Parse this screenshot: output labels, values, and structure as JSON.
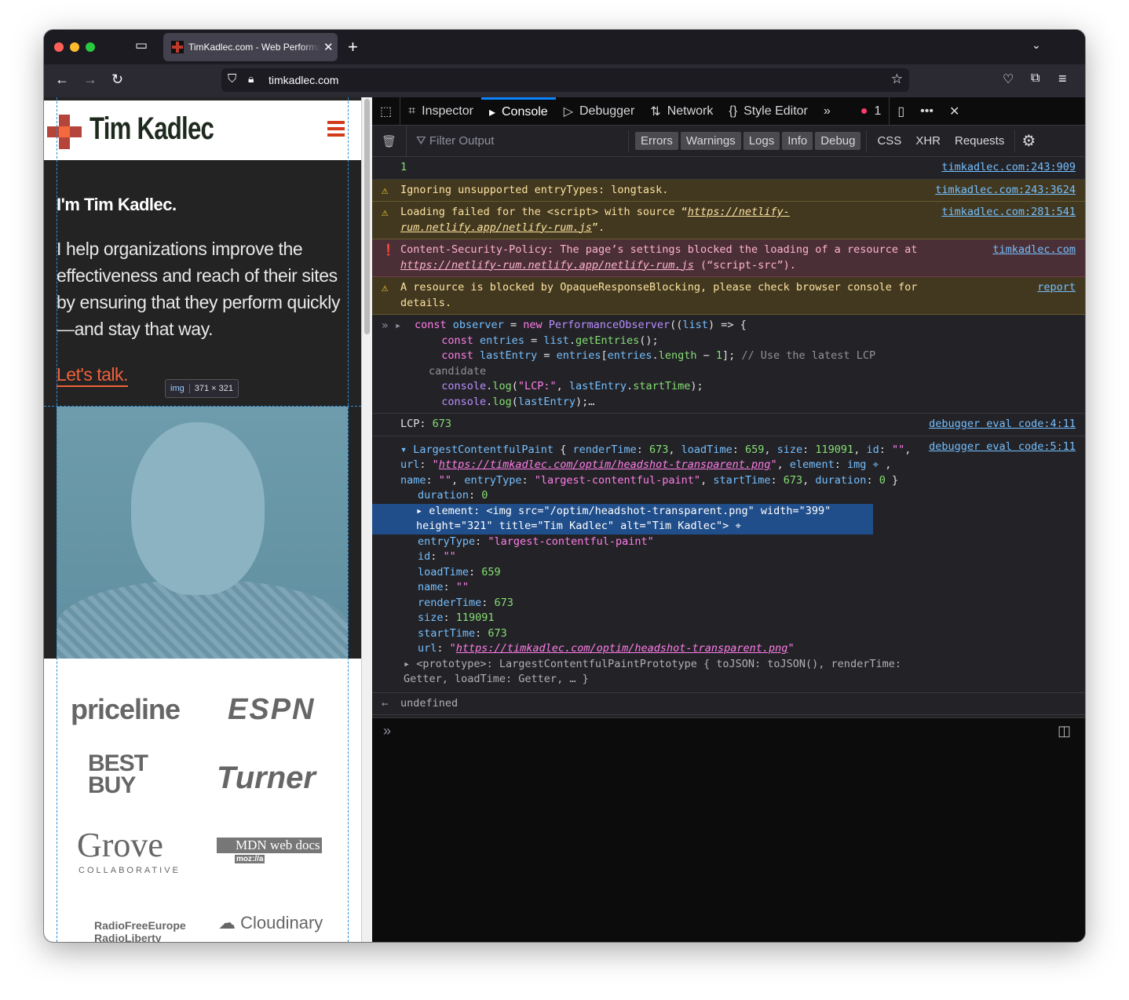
{
  "browser": {
    "tab_title": "TimKadlec.com - Web Performance",
    "url": "timkadlec.com",
    "colors": {
      "close": "#ff5f57",
      "minimize": "#febc2e",
      "zoom": "#28c840"
    }
  },
  "page": {
    "logo": "Tim Kadlec",
    "heading": "I'm Tim Kadlec.",
    "intro": "I help organizations improve the effectiveness and reach of their sites by ensuring that they perform quickly—and stay that way.",
    "cta": "Let's talk.",
    "tooltip": {
      "tag": "img",
      "size": "371 × 321"
    },
    "logos": [
      "priceline",
      "ESPN",
      "BEST BUY",
      "Turner",
      "Grove",
      "COLLABORATIVE",
      "MDN web docs",
      "moz://a",
      "RadioFreeEurope RadioLiberty",
      "Cloudinary"
    ]
  },
  "devtools": {
    "tabs": [
      "Inspector",
      "Console",
      "Debugger",
      "Network",
      "Style Editor"
    ],
    "error_count": "1",
    "filter_placeholder": "Filter Output",
    "levels": [
      "Errors",
      "Warnings",
      "Logs",
      "Info",
      "Debug"
    ],
    "extra": [
      "CSS",
      "XHR",
      "Requests"
    ],
    "accent": "#0a84ff"
  },
  "console": {
    "messages": [
      {
        "type": "log",
        "text": "1",
        "source": "timkadlec.com:243:909"
      },
      {
        "type": "warn",
        "text": "Ignoring unsupported entryTypes: longtask.",
        "source": "timkadlec.com:243:3624"
      },
      {
        "type": "warn",
        "text": "Loading failed for the <script> with source “",
        "link": "https://netlify-rum.netlify.app/netlify-rum.js",
        "after": "”.",
        "source": "timkadlec.com:281:541"
      },
      {
        "type": "err",
        "text": "Content-Security-Policy: The page’s settings blocked the loading of a resource at ",
        "link": "https://netlify-rum.netlify.app/netlify-rum.js",
        "after": " (“script-src”).",
        "source": "timkadlec.com"
      },
      {
        "type": "warn",
        "text": "A resource is blocked by OpaqueResponseBlocking, please check browser console for details.",
        "source": "report"
      }
    ],
    "input_code": [
      [
        [
          "k",
          "const "
        ],
        [
          "v",
          "observer "
        ],
        [
          "p",
          "= "
        ],
        [
          "k",
          "new "
        ],
        [
          "c",
          "PerformanceObserver"
        ],
        [
          "p",
          "(("
        ],
        [
          "v",
          "list"
        ],
        [
          "p",
          ") => {"
        ]
      ],
      [
        [
          "p",
          "  "
        ],
        [
          "k",
          "const "
        ],
        [
          "v",
          "entries "
        ],
        [
          "p",
          "= "
        ],
        [
          "v",
          "list"
        ],
        [
          "p",
          "."
        ],
        [
          "f",
          "getEntries"
        ],
        [
          "p",
          "();"
        ]
      ],
      [
        [
          "p",
          "  "
        ],
        [
          "k",
          "const "
        ],
        [
          "v",
          "lastEntry "
        ],
        [
          "p",
          "= "
        ],
        [
          "v",
          "entries"
        ],
        [
          "p",
          "["
        ],
        [
          "v",
          "entries"
        ],
        [
          "p",
          "."
        ],
        [
          "f",
          "length"
        ],
        [
          "p",
          " − "
        ],
        [
          "n",
          "1"
        ],
        [
          "p",
          "]; "
        ],
        [
          "cm",
          "// Use the latest LCP candidate"
        ]
      ],
      [
        [
          "p",
          "  "
        ],
        [
          "c",
          "console"
        ],
        [
          "p",
          "."
        ],
        [
          "f",
          "log"
        ],
        [
          "p",
          "("
        ],
        [
          "s",
          "\"LCP:\""
        ],
        [
          "p",
          ", "
        ],
        [
          "v",
          "lastEntry"
        ],
        [
          "p",
          "."
        ],
        [
          "f",
          "startTime"
        ],
        [
          "p",
          ");"
        ]
      ],
      [
        [
          "p",
          "  "
        ],
        [
          "c",
          "console"
        ],
        [
          "p",
          "."
        ],
        [
          "f",
          "log"
        ],
        [
          "p",
          "("
        ],
        [
          "v",
          "lastEntry"
        ],
        [
          "p",
          ");…"
        ]
      ]
    ],
    "lcp": {
      "label": "LCP: ",
      "value": "673",
      "source": "debugger eval code:4:11"
    },
    "object_source": "debugger eval code:5:11",
    "object_lines": [
      [
        [
          "v",
          "▾ LargestContentfulPaint "
        ],
        [
          "p",
          "{ "
        ],
        [
          "v",
          "renderTime"
        ],
        [
          "p",
          ": "
        ],
        [
          "n",
          "673"
        ],
        [
          "p",
          ", "
        ],
        [
          "v",
          "loadTime"
        ],
        [
          "p",
          ": "
        ],
        [
          "n",
          "659"
        ],
        [
          "p",
          ", "
        ],
        [
          "v",
          "size"
        ],
        [
          "p",
          ": "
        ],
        [
          "n",
          "119091"
        ],
        [
          "p",
          ", "
        ],
        [
          "v",
          "id"
        ],
        [
          "p",
          ": "
        ],
        [
          "s",
          "\"\""
        ],
        [
          "p",
          ", "
        ],
        [
          "v",
          "url"
        ],
        [
          "p",
          ": "
        ],
        [
          "s",
          "\""
        ],
        [
          "u",
          "https://timkadlec.com/optim/headshot-transparent.png"
        ],
        [
          "s",
          "\""
        ],
        [
          "p",
          ", "
        ],
        [
          "v",
          "element"
        ],
        [
          "p",
          ": "
        ],
        [
          "v",
          "img ⌖ "
        ],
        [
          "p",
          ", "
        ],
        [
          "v",
          "name"
        ],
        [
          "p",
          ": "
        ],
        [
          "s",
          "\"\""
        ],
        [
          "p",
          ", "
        ],
        [
          "v",
          "entryType"
        ],
        [
          "p",
          ": "
        ],
        [
          "s",
          "\"largest-contentful-paint\""
        ],
        [
          "p",
          ", "
        ],
        [
          "v",
          "startTime"
        ],
        [
          "p",
          ": "
        ],
        [
          "n",
          "673"
        ],
        [
          "p",
          ", "
        ],
        [
          "v",
          "duration"
        ],
        [
          "p",
          ": "
        ],
        [
          "n",
          "0"
        ],
        [
          "p",
          " }"
        ]
      ]
    ],
    "props": [
      [
        [
          "v",
          "duration"
        ],
        [
          "p",
          ": "
        ],
        [
          "n",
          "0"
        ]
      ],
      [
        [
          "w",
          "▸ element: <img src=\"/optim/headshot-transparent.png\" width=\"399\" height=\"321\" title=\"Tim Kadlec\" alt=\"Tim Kadlec\"> ⌖"
        ]
      ],
      [
        [
          "v",
          "entryType"
        ],
        [
          "p",
          ": "
        ],
        [
          "s",
          "\"largest-contentful-paint\""
        ]
      ],
      [
        [
          "v",
          "id"
        ],
        [
          "p",
          ": "
        ],
        [
          "s",
          "\"\""
        ]
      ],
      [
        [
          "v",
          "loadTime"
        ],
        [
          "p",
          ": "
        ],
        [
          "n",
          "659"
        ]
      ],
      [
        [
          "v",
          "name"
        ],
        [
          "p",
          ": "
        ],
        [
          "s",
          "\"\""
        ]
      ],
      [
        [
          "v",
          "renderTime"
        ],
        [
          "p",
          ": "
        ],
        [
          "n",
          "673"
        ]
      ],
      [
        [
          "v",
          "size"
        ],
        [
          "p",
          ": "
        ],
        [
          "n",
          "119091"
        ]
      ],
      [
        [
          "v",
          "startTime"
        ],
        [
          "p",
          ": "
        ],
        [
          "n",
          "673"
        ]
      ],
      [
        [
          "v",
          "url"
        ],
        [
          "p",
          ": "
        ],
        [
          "s",
          "\""
        ],
        [
          "u",
          "https://timkadlec.com/optim/headshot-transparent.png"
        ],
        [
          "s",
          "\""
        ]
      ],
      [
        [
          "g",
          "▸ <prototype>: LargestContentfulPaintPrototype { toJSON: toJSON(), renderTime: Getter, loadTime: Getter, … }"
        ]
      ]
    ],
    "result": "undefined"
  }
}
